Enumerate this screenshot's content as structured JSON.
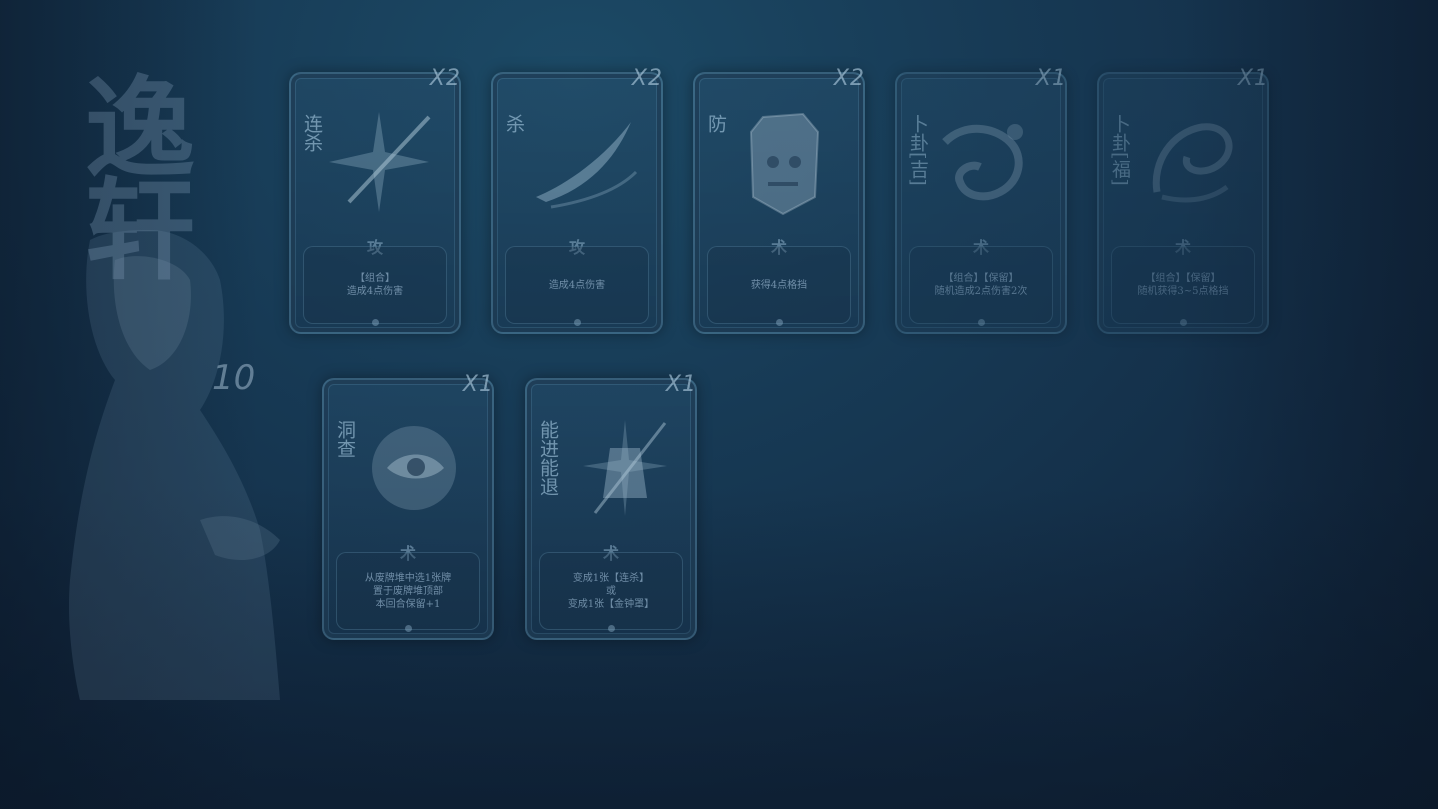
{
  "hero": {
    "title": "逸轩",
    "level": "10"
  },
  "cards": [
    {
      "count": "X2",
      "name": "连杀",
      "type": "攻",
      "desc": "【组合】\n造成4点伤害",
      "icon": "starburst-blade-icon"
    },
    {
      "count": "X2",
      "name": "杀",
      "type": "攻",
      "desc": "造成4点伤害",
      "icon": "slash-blade-icon"
    },
    {
      "count": "X2",
      "name": "防",
      "type": "术",
      "desc": "获得4点格挡",
      "icon": "demon-shield-icon"
    },
    {
      "count": "X1",
      "name": "卜卦[吉]",
      "type": "术",
      "desc": "【组合】【保留】\n随机造成2点伤害2次",
      "icon": "dragon-divination-icon"
    },
    {
      "count": "X1",
      "name": "卜卦[福]",
      "type": "术",
      "desc": "【组合】【保留】\n随机获得3~5点格挡",
      "icon": "phoenix-divination-icon"
    },
    {
      "count": "X1",
      "name": "洞查",
      "type": "术",
      "desc": "从废牌堆中选1张牌\n置于废牌堆顶部\n本回合保留+1",
      "icon": "eye-cloud-icon"
    },
    {
      "count": "X1",
      "name": "能进能退",
      "type": "术",
      "desc": "变成1张【连杀】\n或\n变成1张【金钟罩】",
      "icon": "bell-burst-icon"
    }
  ],
  "colors": {
    "background": "#173a55",
    "card_border": "#6ea0be",
    "text": "#96b4cd"
  }
}
